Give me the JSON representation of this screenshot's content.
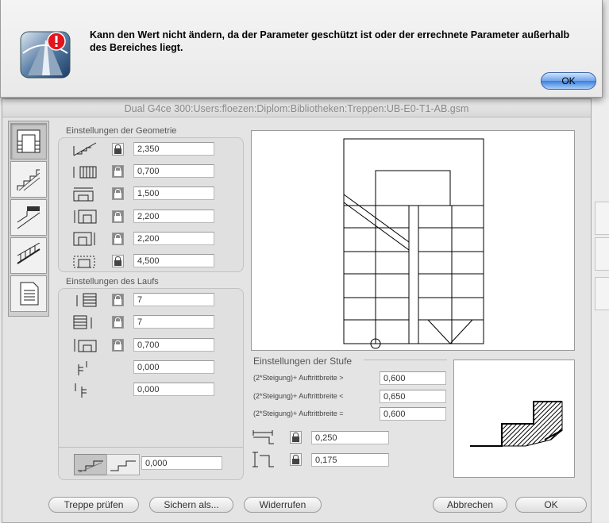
{
  "alert": {
    "message": "Kann den Wert nicht ändern, da der Parameter geschützt ist oder der errechnete Parameter außerhalb des Bereiches liegt.",
    "ok_label": "OK",
    "icon": "warning-badge-icon"
  },
  "dialog": {
    "title": "Dual G4ce 300:Users:floezen:Diplom:Bibliotheken:Treppen:UB-E0-T1-AB.gsm"
  },
  "tabs": [
    {
      "icon": "stair-plan-icon",
      "selected": true
    },
    {
      "icon": "stair-section-icon",
      "selected": false
    },
    {
      "icon": "stair-side-icon",
      "selected": false
    },
    {
      "icon": "railing-icon",
      "selected": false
    },
    {
      "icon": "document-icon",
      "selected": false
    }
  ],
  "geometry": {
    "label": "Einstellungen der Geometrie",
    "rows": [
      {
        "icon": "total-length-icon",
        "locked": false,
        "value": "2,350"
      },
      {
        "icon": "landing-width-icon",
        "locked": true,
        "value": "0,700"
      },
      {
        "icon": "stair-width-icon",
        "locked": true,
        "value": "1,500"
      },
      {
        "icon": "height-a-icon",
        "locked": true,
        "value": "2,200"
      },
      {
        "icon": "height-b-icon",
        "locked": true,
        "value": "2,200"
      },
      {
        "icon": "outline-icon",
        "locked": false,
        "value": "4,500"
      }
    ]
  },
  "run": {
    "label": "Einstellungen des Laufs",
    "rows": [
      {
        "icon": "steps-up-icon",
        "locked": true,
        "value": "7"
      },
      {
        "icon": "steps-down-icon",
        "locked": true,
        "value": "7"
      },
      {
        "icon": "flight-width-icon",
        "locked": true,
        "value": "0,700"
      },
      {
        "icon": "offset-a-icon",
        "locked": null,
        "value": "0,000"
      },
      {
        "icon": "offset-b-icon",
        "locked": null,
        "value": "0,000"
      }
    ],
    "bottom_value": "0,000"
  },
  "step": {
    "label": "Einstellungen der Stufe",
    "rules": [
      {
        "text": "(2*Steigung)+ Auftrittbreite >",
        "value": "0,600"
      },
      {
        "text": "(2*Steigung)+ Auftrittbreite <",
        "value": "0,650"
      },
      {
        "text": "(2*Steigung)+ Auftrittbreite =",
        "value": "0,600"
      }
    ],
    "tread": {
      "locked": false,
      "value": "0,250"
    },
    "riser": {
      "locked": false,
      "value": "0,175"
    }
  },
  "buttons": {
    "check": "Treppe prüfen",
    "save_as": "Sichern als...",
    "revert": "Widerrufen",
    "cancel": "Abbrechen",
    "ok": "OK"
  }
}
